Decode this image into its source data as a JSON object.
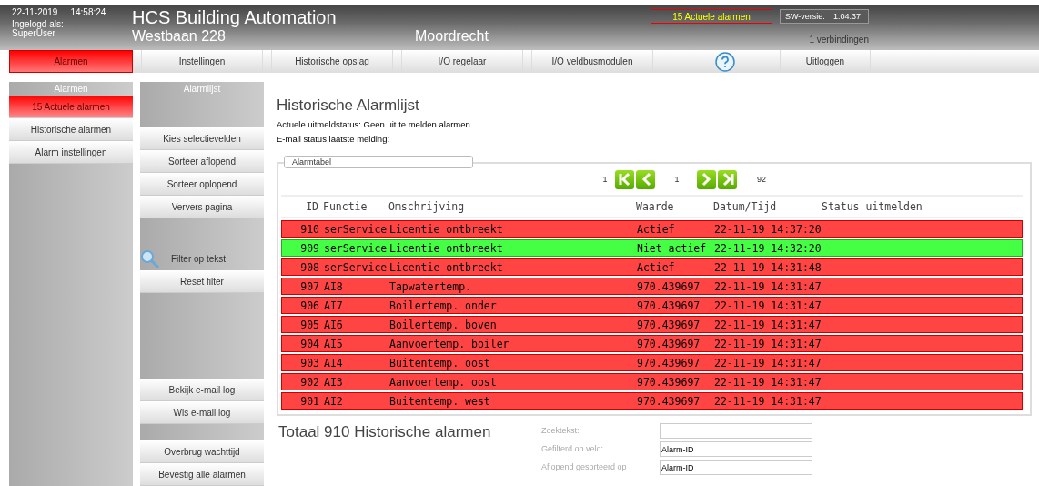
{
  "header": {
    "date": "22-11-2019",
    "time": "14:58:24",
    "login_label": "Ingelogd als:",
    "user": "SuperUser",
    "title": "HCS Building Automation",
    "address": "Westbaan 228",
    "city": "Moordrecht",
    "alarm_badge": "15 Actuele alarmen",
    "sw_label": "SW-versie:",
    "sw_version": "1.04.37",
    "connections": "1 verbindingen"
  },
  "nav": [
    {
      "label": "Alarmen",
      "selected": true
    },
    {
      "label": "Instellingen",
      "selected": false
    },
    {
      "label": "Historische opslag",
      "selected": false
    },
    {
      "label": "I/O regelaar",
      "selected": false
    },
    {
      "label": "I/O veldbusmodulen",
      "selected": false
    },
    {
      "label": "Uitloggen",
      "selected": false
    }
  ],
  "sidebar": {
    "title": "Alarmen",
    "items": [
      {
        "label": "15 Actuele alarmen",
        "selected": true
      },
      {
        "label": "Historische alarmen",
        "selected": false
      },
      {
        "label": "Alarm instellingen",
        "selected": false
      }
    ]
  },
  "actions": {
    "title": "Alarmlijst",
    "groups": [
      {
        "items": [
          {
            "kind": "button",
            "label": "Kies selectievelden"
          },
          {
            "kind": "button",
            "label": "Sorteer aflopend"
          },
          {
            "kind": "button",
            "label": "Sorteer oplopend"
          },
          {
            "kind": "button",
            "label": "Ververs pagina"
          }
        ]
      },
      {
        "items": [
          {
            "kind": "filter",
            "label": "Filter op tekst"
          },
          {
            "kind": "button",
            "label": "Reset filter"
          }
        ]
      },
      {
        "items": [
          {
            "kind": "button",
            "label": "Bekijk e-mail log"
          },
          {
            "kind": "button",
            "label": "Wis e-mail log"
          }
        ]
      },
      {
        "items": [
          {
            "kind": "button",
            "label": "Overbrug wachttijd"
          },
          {
            "kind": "button",
            "label": "Bevestig alle alarmen"
          }
        ]
      }
    ]
  },
  "content": {
    "title": "Historische Alarmlijst",
    "status_lines": [
      "Actuele uitmeldstatus: Geen uit te melden alarmen......",
      "E-mail status laatste melding:"
    ],
    "table": {
      "legend": "Alarmtabel",
      "pager": {
        "first": "1",
        "current": "1",
        "last": "92"
      },
      "columns": [
        "ID",
        "Functie",
        "Omschrijving",
        "Waarde",
        "Datum/Tijd",
        "Status uitmelden"
      ],
      "rows": [
        {
          "id": "910",
          "function": "serService",
          "description": "Licentie ontbreekt",
          "value": "Actief",
          "datetime": "22-11-19 14:37:20",
          "active": true
        },
        {
          "id": "909",
          "function": "serService",
          "description": "Licentie ontbreekt",
          "value": "Niet actief",
          "datetime": "22-11-19 14:32:20",
          "active": false
        },
        {
          "id": "908",
          "function": "serService",
          "description": "Licentie ontbreekt",
          "value": "Actief",
          "datetime": "22-11-19 14:31:48",
          "active": true
        },
        {
          "id": "907",
          "function": "AI8",
          "description": "Tapwatertemp.",
          "value": "970.439697",
          "datetime": "22-11-19 14:31:47",
          "active": true
        },
        {
          "id": "906",
          "function": "AI7",
          "description": "Boilertemp. onder",
          "value": "970.439697",
          "datetime": "22-11-19 14:31:47",
          "active": true
        },
        {
          "id": "905",
          "function": "AI6",
          "description": "Boilertemp. boven",
          "value": "970.439697",
          "datetime": "22-11-19 14:31:47",
          "active": true
        },
        {
          "id": "904",
          "function": "AI5",
          "description": "Aanvoertemp. boiler",
          "value": "970.439697",
          "datetime": "22-11-19 14:31:47",
          "active": true
        },
        {
          "id": "903",
          "function": "AI4",
          "description": "Buitentemp. oost",
          "value": "970.439697",
          "datetime": "22-11-19 14:31:47",
          "active": true
        },
        {
          "id": "902",
          "function": "AI3",
          "description": "Aanvoertemp. oost",
          "value": "970.439697",
          "datetime": "22-11-19 14:31:47",
          "active": true
        },
        {
          "id": "901",
          "function": "AI2",
          "description": "Buitentemp. west",
          "value": "970.439697",
          "datetime": "22-11-19 14:31:47",
          "active": true
        }
      ]
    },
    "total": "Totaal 910 Historische alarmen",
    "fields": [
      {
        "label": "Zoektekst:"
      },
      {
        "label": "Gefilterd op veld:",
        "value": "Alarm-ID"
      },
      {
        "label": "Aflopend gesorteerd op",
        "value": "Alarm-ID"
      }
    ]
  }
}
